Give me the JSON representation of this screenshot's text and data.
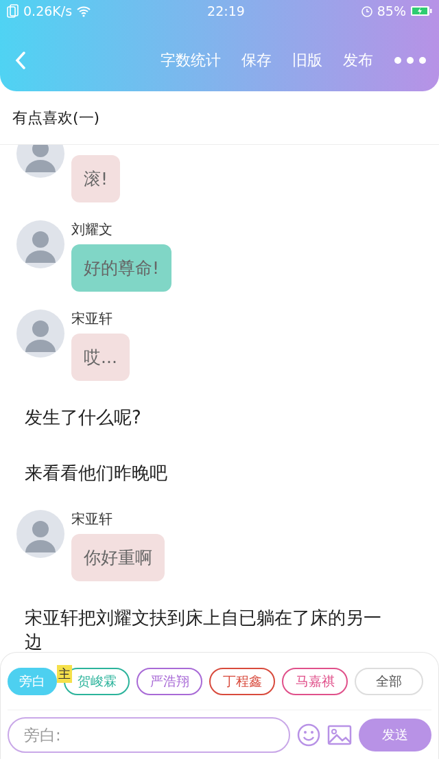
{
  "status_bar": {
    "network_speed": "0.26K/s",
    "time": "22:19",
    "battery": "85%"
  },
  "header": {
    "actions": [
      "字数统计",
      "保存",
      "旧版",
      "发布"
    ]
  },
  "title": "有点喜欢(一)",
  "messages": [
    {
      "kind": "bubble",
      "text": "滚!",
      "color": "#f3dfdf"
    },
    {
      "kind": "bubble",
      "name": "刘耀文",
      "text": "好的尊命!",
      "color": "#80d6c6"
    },
    {
      "kind": "bubble",
      "name": "宋亚轩",
      "text": "哎...",
      "color": "#f3dfdf"
    },
    {
      "kind": "narration",
      "text": "发生了什么呢?"
    },
    {
      "kind": "narration",
      "text": "来看看他们昨晚吧"
    },
    {
      "kind": "bubble",
      "name": "宋亚轩",
      "text": "你好重啊",
      "color": "#f3dfdf"
    },
    {
      "kind": "narration",
      "text": "宋亚轩把刘耀文扶到床上自已躺在了床的另一边"
    }
  ],
  "roles": [
    {
      "label": "旁白",
      "selected": true,
      "color": "#4dd0f0"
    },
    {
      "label": "贺峻霖",
      "selected": false,
      "color": "#2bb39b",
      "badge": "主"
    },
    {
      "label": "严浩翔",
      "selected": false,
      "color": "#a86ad6"
    },
    {
      "label": "丁程鑫",
      "selected": false,
      "color": "#d84a3c"
    },
    {
      "label": "马嘉祺",
      "selected": false,
      "color": "#e0508a"
    },
    {
      "label": "全部",
      "selected": false,
      "color": "#dddddd"
    }
  ],
  "composer": {
    "placeholder": "旁白:",
    "send": "发送"
  }
}
